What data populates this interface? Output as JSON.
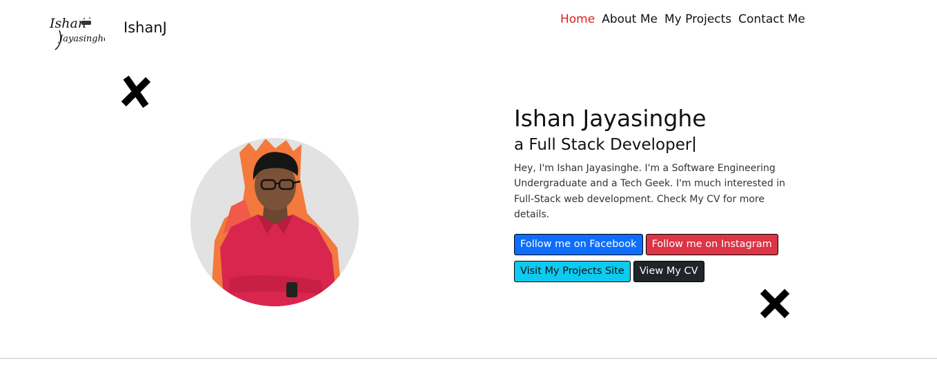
{
  "header": {
    "logo_lines": [
      "Ishan",
      "Jayasinghe"
    ],
    "brand_name": "IshanJ",
    "nav": [
      {
        "label": "Home",
        "active": true
      },
      {
        "label": "About Me",
        "active": false
      },
      {
        "label": "My Projects",
        "active": false
      },
      {
        "label": "Contact Me",
        "active": false
      }
    ]
  },
  "hero": {
    "name": "Ishan Jayasinghe",
    "role": "a Full Stack Developer",
    "description": "Hey, I'm Ishan Jayasinghe. I'm a Software Engineering Undergraduate and a Tech Geek. I'm much interested in Full-Stack web development. Check My CV for more details.",
    "buttons": {
      "facebook": "Follow me on Facebook",
      "instagram": "Follow me on Instagram",
      "projects": "Visit My Projects Site",
      "cv": "View My CV"
    }
  },
  "colors": {
    "nav_active": "#e01c1c",
    "facebook": "#0d6efd",
    "instagram": "#dc3545",
    "projects": "#0dcaf0",
    "cv": "#212529"
  },
  "icons": {
    "decorations": [
      "x-mark-icon",
      "x-mark-icon"
    ]
  }
}
